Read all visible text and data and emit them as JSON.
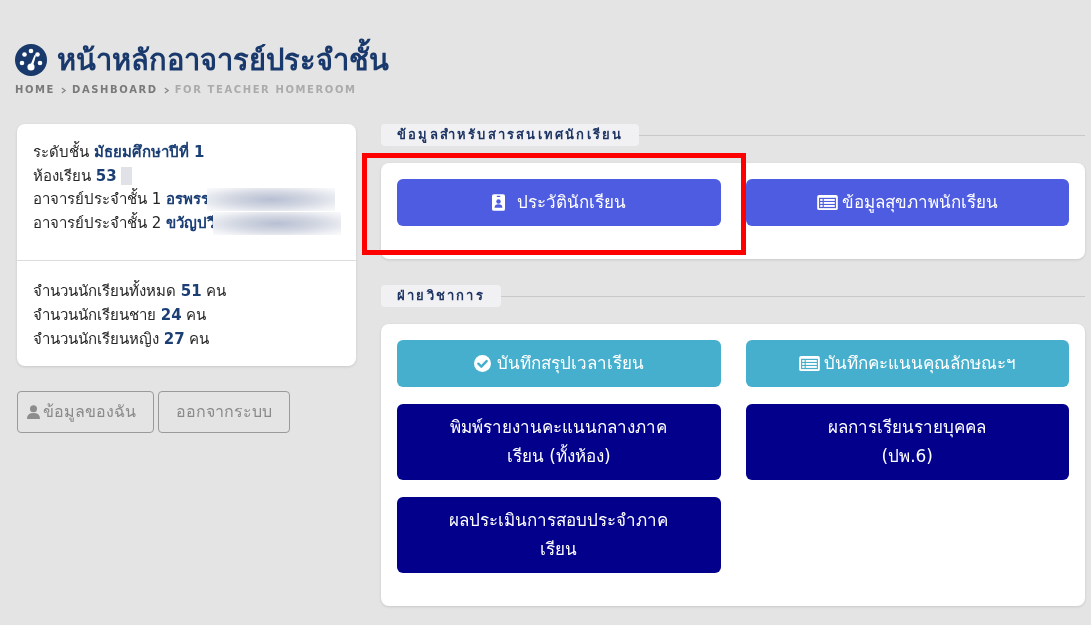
{
  "page": {
    "title": "หน้าหลักอาจารย์ประจำชั้น",
    "breadcrumb": [
      {
        "label": "HOME",
        "current": false
      },
      {
        "label": "DASHBOARD",
        "current": false
      },
      {
        "label": "FOR TEACHER HOMEROOM",
        "current": true
      }
    ]
  },
  "class_info": {
    "details": [
      {
        "text": "ระดับชั้น **มัธยมศึกษาปีที่ 1**",
        "kind": "plain"
      },
      {
        "text": "ห้องเรียน **53**",
        "kind": "masked"
      },
      {
        "text": "อาจารย์ประจำชั้น 1 **อรพรร**",
        "kind": "blurred"
      },
      {
        "text": "อาจารย์ประจำชั้น 2 **ขวัญปวี**",
        "kind": "blurred"
      }
    ],
    "counts": [
      "จำนวนนักเรียนทั้งหมด **51** คน",
      "จำนวนนักเรียนชาย **24** คน",
      "จำนวนนักเรียนหญิง **27** คน"
    ]
  },
  "account_buttons": [
    {
      "label": "ข้อมูลของฉัน",
      "kind": "profile"
    },
    {
      "label": "ออกจากระบบ",
      "kind": "logout"
    }
  ],
  "sections": [
    {
      "title": "ข้อมูลสำหรับสารสนเทศนักเรียน",
      "buttons": [
        {
          "label": "ประวัตินักเรียน",
          "kind": "profile",
          "highlighted": true
        },
        {
          "label": "ข้อมูลสุขภาพนักเรียน",
          "kind": "health",
          "highlighted": false
        }
      ]
    },
    {
      "title": "ฝ่ายวิชาการ",
      "buttons": [
        {
          "label": "บันทึกสรุปเวลาเรียน",
          "kind": "attendance",
          "highlighted": false
        },
        {
          "label": "บันทึกคะแนนคุณลักษณะฯ",
          "kind": "traits",
          "highlighted": false
        },
        {
          "label": "พิมพ์รายงานคะแนนกลางภาค\nเรียน (ทั้งห้อง)",
          "kind": "report",
          "highlighted": false
        },
        {
          "label": "ผลการเรียนรายบุคคล\n(ปพ.6)",
          "kind": "report",
          "highlighted": false
        },
        {
          "label": "ผลประเมินการสอบประจำภาค\nเรียน",
          "kind": "report",
          "highlighted": false
        }
      ]
    }
  ]
}
